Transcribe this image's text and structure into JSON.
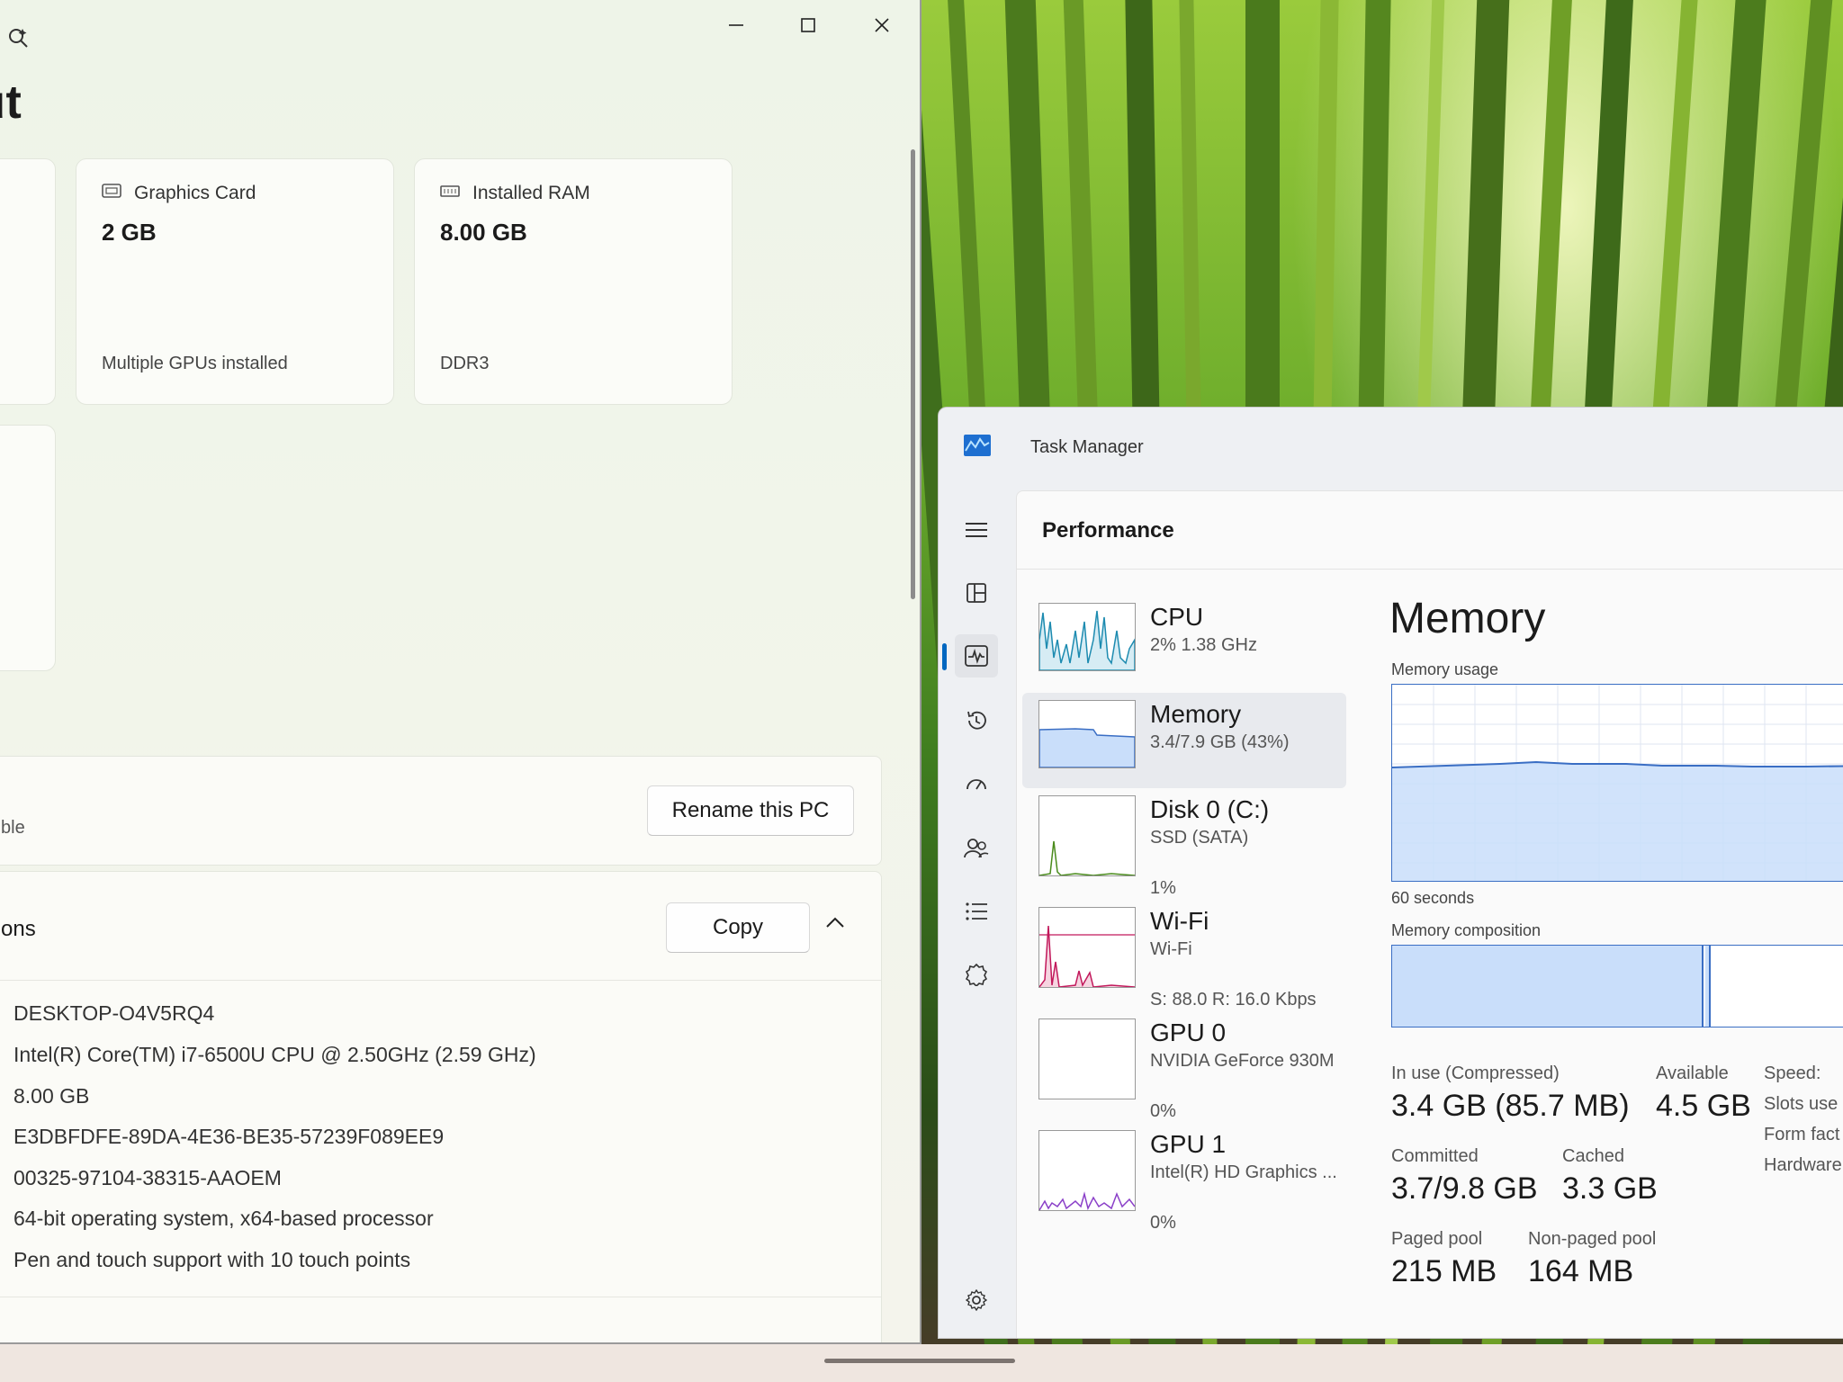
{
  "settings": {
    "page_title": "out",
    "cards": [
      {
        "heading": "Graphics Card",
        "value": "2 GB",
        "sub": "Multiple GPUs installed"
      },
      {
        "heading": "Installed RAM",
        "value": "8.00 GB",
        "sub": "DDR3"
      }
    ],
    "rename_panel": {
      "desc_fragment": "ble",
      "button": "Rename this PC"
    },
    "specs_panel": {
      "title_fragment": "ons",
      "copy_button": "Copy",
      "rows": [
        "DESKTOP-O4V5RQ4",
        "Intel(R) Core(TM) i7-6500U CPU @ 2.50GHz (2.59 GHz)",
        "8.00 GB",
        "E3DBFDFE-89DA-4E36-BE35-57239F089EE9",
        "00325-97104-38315-AAOEM",
        "64-bit operating system, x64-based processor",
        "Pen and touch support with 10 touch points"
      ]
    }
  },
  "taskmgr": {
    "title": "Task Manager",
    "section": "Performance",
    "items": [
      {
        "name": "CPU",
        "line2": "2% 1.38 GHz",
        "line3": ""
      },
      {
        "name": "Memory",
        "line2": "3.4/7.9 GB (43%)",
        "line3": ""
      },
      {
        "name": "Disk 0 (C:)",
        "line2": "SSD (SATA)",
        "line3": "1%"
      },
      {
        "name": "Wi-Fi",
        "line2": "Wi-Fi",
        "line3": "S: 88.0 R: 16.0 Kbps"
      },
      {
        "name": "GPU 0",
        "line2": "NVIDIA GeForce 930M",
        "line3": "0%"
      },
      {
        "name": "GPU 1",
        "line2": "Intel(R) HD Graphics ...",
        "line3": "0%"
      }
    ],
    "detail": {
      "title": "Memory",
      "usage_label": "Memory usage",
      "time_label": "60 seconds",
      "composition_label": "Memory composition",
      "stats": {
        "in_use_label": "In use (Compressed)",
        "in_use": "3.4 GB (85.7 MB)",
        "available_label": "Available",
        "available": "4.5 GB",
        "committed_label": "Committed",
        "committed": "3.7/9.8 GB",
        "cached_label": "Cached",
        "cached": "3.3 GB",
        "paged_label": "Paged pool",
        "paged": "215 MB",
        "nonpaged_label": "Non-paged pool",
        "nonpaged": "164 MB",
        "speed_label": "Speed:",
        "slots_label": "Slots use",
        "form_label": "Form fact",
        "hardware_label": "Hardware"
      }
    }
  },
  "colors": {
    "mem_fill": "#c9defa",
    "mem_line": "#3a6ec4",
    "cpu_line": "#1d8bb0",
    "disk_line": "#4a8b1c",
    "wifi_line": "#c2185b",
    "gpu1_line": "#8a3fc8",
    "accent": "#0067c0"
  }
}
